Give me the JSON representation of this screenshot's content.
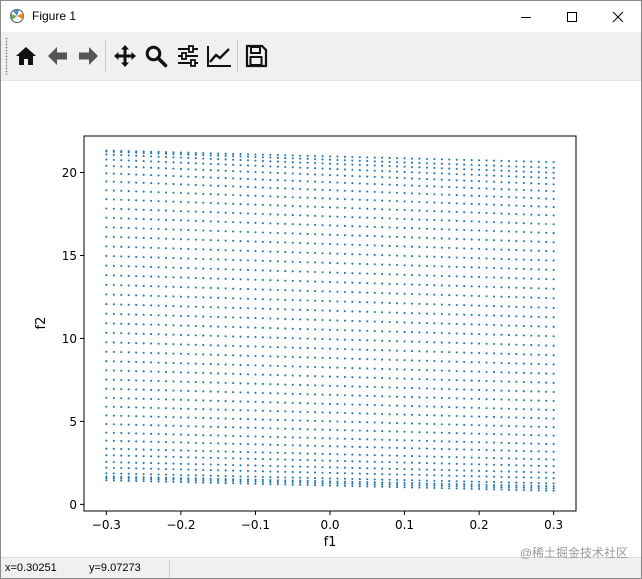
{
  "window": {
    "title": "Figure 1",
    "app_icon": "matplotlib-icon",
    "controls": [
      "minimize-icon",
      "maximize-icon",
      "close-icon"
    ]
  },
  "toolbar": {
    "buttons": [
      {
        "name": "home-button",
        "icon": "home-icon",
        "tooltip": "Reset original view"
      },
      {
        "name": "back-button",
        "icon": "arrow-left-icon",
        "tooltip": "Back to previous view"
      },
      {
        "name": "forward-button",
        "icon": "arrow-right-icon",
        "tooltip": "Forward to next view"
      },
      {
        "name": "pan-button",
        "icon": "move-icon",
        "tooltip": "Pan axes"
      },
      {
        "name": "zoom-button",
        "icon": "magnifier-icon",
        "tooltip": "Zoom to rectangle"
      },
      {
        "name": "subplots-button",
        "icon": "sliders-icon",
        "tooltip": "Configure subplots"
      },
      {
        "name": "edit-axes-button",
        "icon": "chart-line-icon",
        "tooltip": "Edit axis"
      },
      {
        "name": "save-button",
        "icon": "floppy-disk-icon",
        "tooltip": "Save the figure"
      }
    ]
  },
  "chart_data": {
    "type": "scatter",
    "title": "",
    "xlabel": "f1",
    "ylabel": "f2",
    "xlim": [
      -0.33,
      0.33
    ],
    "ylim": [
      -0.4,
      22.2
    ],
    "xticks": [
      -0.3,
      -0.2,
      -0.1,
      0.0,
      0.1,
      0.2,
      0.3
    ],
    "xtick_labels": [
      "−0.3",
      "−0.2",
      "−0.1",
      "0.0",
      "0.1",
      "0.2",
      "0.3"
    ],
    "yticks": [
      0,
      5,
      10,
      15,
      20
    ],
    "ytick_labels": [
      "0",
      "5",
      "10",
      "15",
      "20"
    ],
    "grid": false,
    "color": "#1f77b4",
    "series": [
      {
        "x_start": -0.3,
        "x_end": 0.3,
        "points_per_row": 61,
        "y_left": [
          1.45,
          1.58,
          1.68,
          1.87,
          2.21,
          2.55,
          2.96,
          3.36,
          3.84,
          4.32,
          4.84,
          5.36,
          5.89,
          6.42,
          6.97,
          7.52,
          8.08,
          8.63,
          9.2,
          9.77,
          10.34,
          10.91,
          11.49,
          12.07,
          12.65,
          13.23,
          13.81,
          14.39,
          14.97,
          15.55,
          16.13,
          16.7,
          17.27,
          17.83,
          18.39,
          18.93,
          19.46,
          19.95,
          20.4,
          20.78,
          21.08,
          21.26,
          21.32
        ],
        "y_right": [
          0.82,
          0.96,
          1.09,
          1.26,
          1.58,
          1.91,
          2.3,
          2.7,
          3.17,
          3.63,
          4.14,
          4.65,
          5.17,
          5.69,
          6.23,
          6.77,
          7.32,
          7.87,
          8.43,
          8.99,
          9.56,
          10.13,
          10.7,
          11.27,
          11.84,
          12.42,
          12.99,
          13.56,
          14.13,
          14.69,
          15.25,
          15.8,
          16.35,
          16.88,
          17.41,
          17.92,
          18.41,
          18.87,
          19.29,
          19.66,
          19.98,
          20.28,
          20.62
        ]
      }
    ]
  },
  "status": {
    "x_readout": "x=0.30251",
    "y_readout": "y=9.07273"
  },
  "watermark": "@稀土掘金技术社区"
}
